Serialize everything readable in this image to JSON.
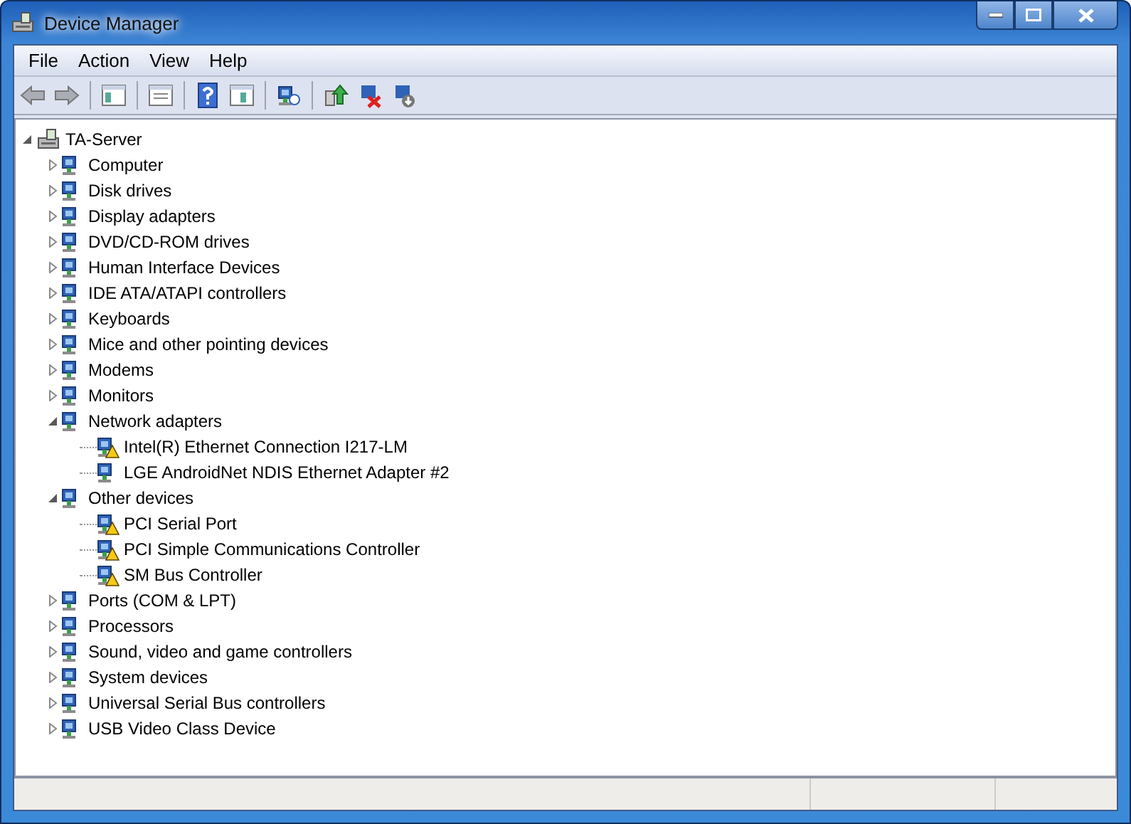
{
  "window": {
    "title": "Device Manager"
  },
  "menu": [
    "File",
    "Action",
    "View",
    "Help"
  ],
  "tree": {
    "label": "TA-Server",
    "expanded": true,
    "children": [
      {
        "label": "Computer",
        "expanded": false
      },
      {
        "label": "Disk drives",
        "expanded": false
      },
      {
        "label": "Display adapters",
        "expanded": false
      },
      {
        "label": "DVD/CD-ROM drives",
        "expanded": false
      },
      {
        "label": "Human Interface Devices",
        "expanded": false
      },
      {
        "label": "IDE ATA/ATAPI controllers",
        "expanded": false
      },
      {
        "label": "Keyboards",
        "expanded": false
      },
      {
        "label": "Mice and other pointing devices",
        "expanded": false
      },
      {
        "label": "Modems",
        "expanded": false
      },
      {
        "label": "Monitors",
        "expanded": false
      },
      {
        "label": "Network adapters",
        "expanded": true,
        "children": [
          {
            "label": "Intel(R) Ethernet Connection I217-LM",
            "warning": true
          },
          {
            "label": "LGE AndroidNet NDIS Ethernet Adapter #2",
            "warning": false
          }
        ]
      },
      {
        "label": "Other devices",
        "expanded": true,
        "children": [
          {
            "label": "PCI Serial Port",
            "warning": true
          },
          {
            "label": "PCI Simple Communications Controller",
            "warning": true
          },
          {
            "label": "SM Bus Controller",
            "warning": true
          }
        ]
      },
      {
        "label": "Ports (COM & LPT)",
        "expanded": false
      },
      {
        "label": "Processors",
        "expanded": false
      },
      {
        "label": "Sound, video and game controllers",
        "expanded": false
      },
      {
        "label": "System devices",
        "expanded": false
      },
      {
        "label": "Universal Serial Bus controllers",
        "expanded": false
      },
      {
        "label": "USB Video Class Device",
        "expanded": false
      }
    ]
  }
}
